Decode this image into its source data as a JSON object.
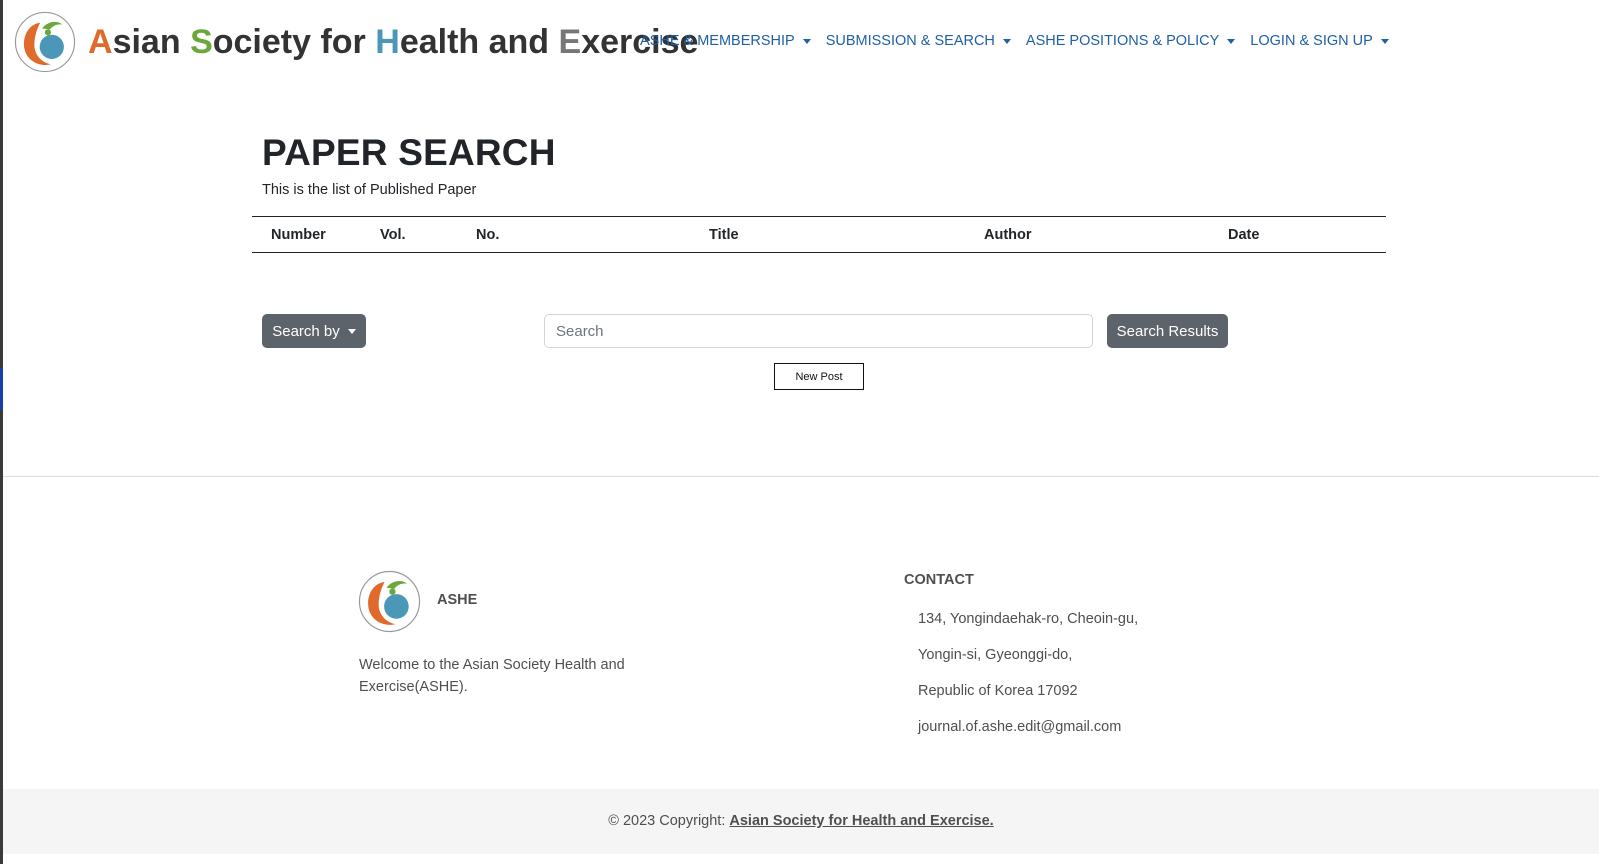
{
  "header": {
    "brand": {
      "w1_first": "A",
      "w1_rest": "sian",
      "w2_first": "S",
      "w2_rest": "ociety for",
      "w3_first": "H",
      "w3_rest": "ealth and",
      "w4_first": "E",
      "w4_rest": "xercise"
    },
    "nav": [
      {
        "label": "ASHE & MEMBERSHIP"
      },
      {
        "label": "SUBMISSION & SEARCH"
      },
      {
        "label": "ASHE POSITIONS & POLICY"
      },
      {
        "label": "LOGIN & SIGN UP"
      }
    ]
  },
  "main": {
    "title": "PAPER SEARCH",
    "subtitle": "This is the list of Published Paper",
    "table": {
      "columns": [
        "Number",
        "Vol.",
        "No.",
        "Title",
        "Author",
        "Date"
      ],
      "rows": []
    },
    "search": {
      "search_by_label": "Search by",
      "placeholder": "Search",
      "value": "",
      "submit_label": "Search Results"
    },
    "new_post_label": "New Post"
  },
  "footer": {
    "name": "ASHE",
    "welcome": "Welcome to the Asian Society Health and Exercise(ASHE).",
    "contact_heading": "CONTACT",
    "contact_lines": [
      "134, Yongindaehak-ro, Cheoin-gu,",
      "Yongin-si, Gyeonggi-do,",
      "Republic of Korea 17092",
      "journal.of.ashe.edit@gmail.com"
    ],
    "copyright_prefix": "© 2023 Copyright:",
    "copyright_link": "Asian Society for Health and Exercise."
  },
  "colors": {
    "nav_link": "#1f5fa6",
    "button_bg": "#5c636a",
    "logo_orange": "#e06a2c",
    "logo_green": "#6aa83c",
    "logo_blue": "#4a97b8"
  },
  "icons": [
    "ashe-logo-icon",
    "caret-down-icon"
  ]
}
